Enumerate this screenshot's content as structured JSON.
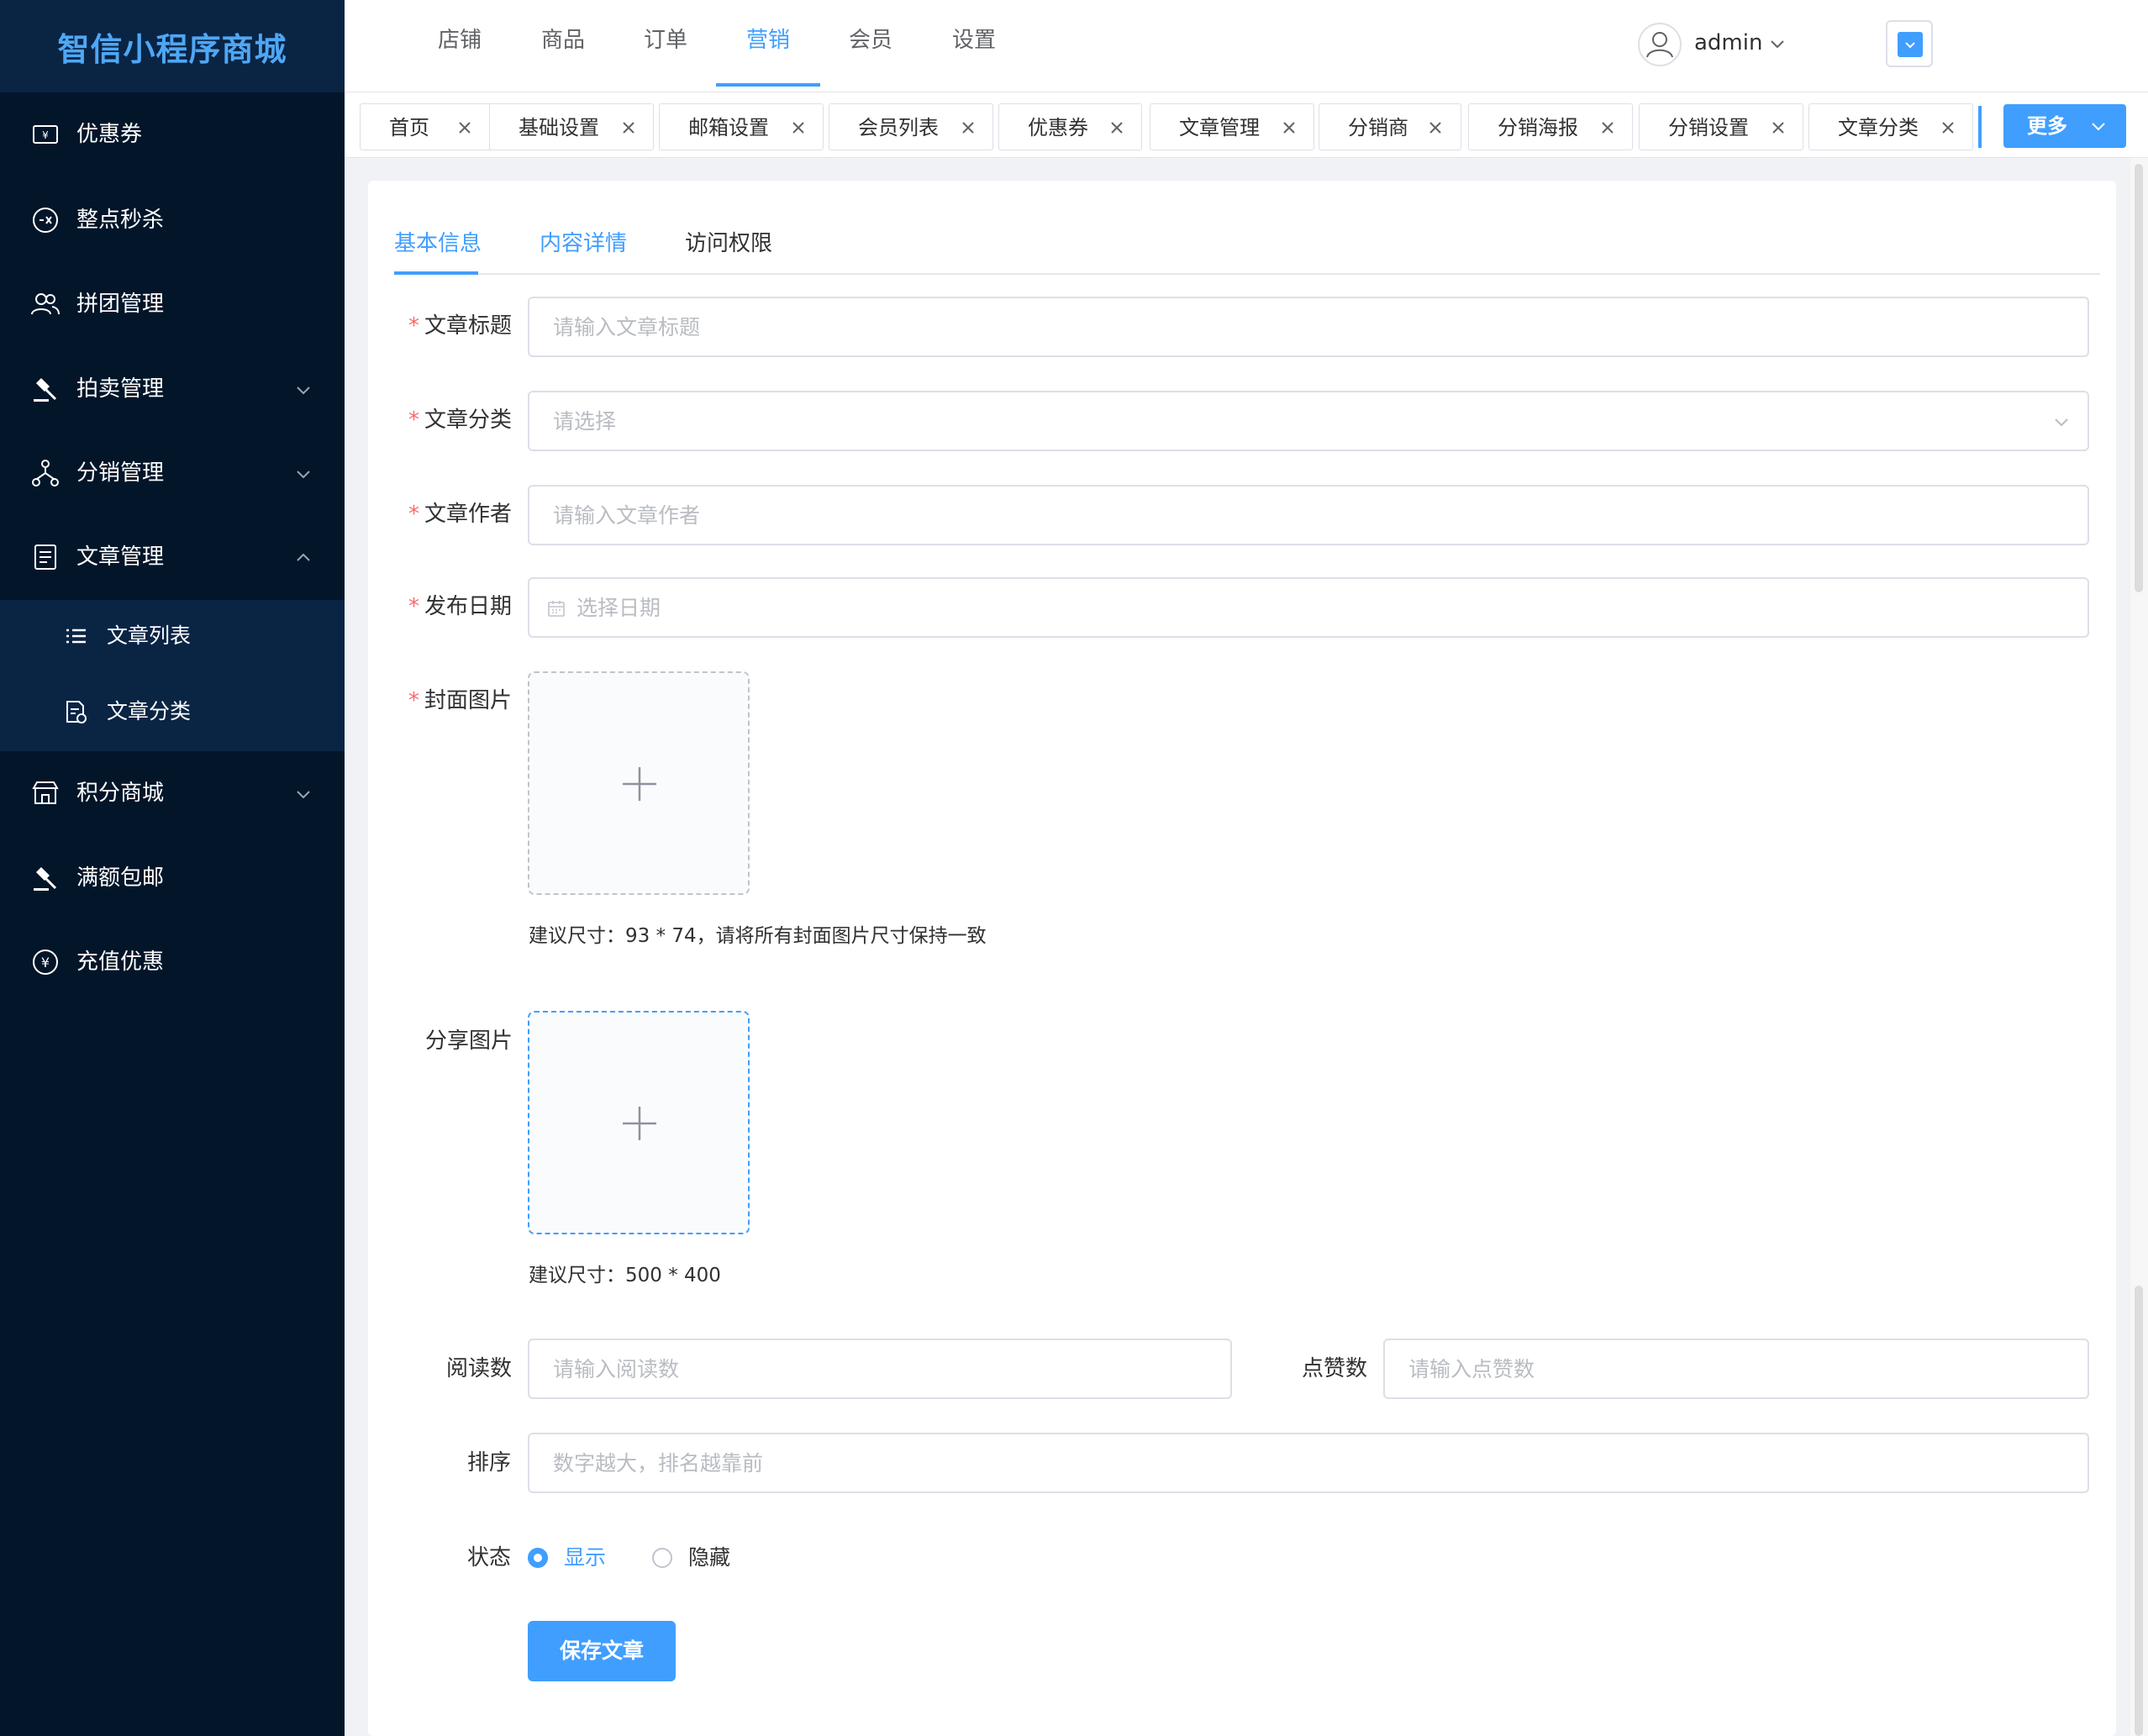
{
  "app": {
    "title": "智信小程序商城"
  },
  "sidebar": {
    "items": [
      {
        "label": "优惠券",
        "icon": "coupon-icon"
      },
      {
        "label": "整点秒杀",
        "icon": "flash-sale-icon"
      },
      {
        "label": "拼团管理",
        "icon": "group-users-icon"
      },
      {
        "label": "拍卖管理",
        "icon": "gavel-icon",
        "expandable": true
      },
      {
        "label": "分销管理",
        "icon": "network-icon",
        "expandable": true
      },
      {
        "label": "文章管理",
        "icon": "document-icon",
        "expanded": true
      },
      {
        "label": "积分商城",
        "icon": "store-icon",
        "expandable": true
      },
      {
        "label": "满额包邮",
        "icon": "gavel-icon"
      },
      {
        "label": "充值优惠",
        "icon": "yuan-coin-icon"
      }
    ],
    "submenu": [
      {
        "label": "文章列表",
        "icon": "list-icon"
      },
      {
        "label": "文章分类",
        "icon": "category-doc-icon"
      }
    ]
  },
  "header": {
    "nav": [
      "店铺",
      "商品",
      "订单",
      "营销",
      "会员",
      "设置"
    ],
    "active_nav": "营销",
    "user": "admin"
  },
  "tabs": {
    "items": [
      "首页",
      "基础设置",
      "邮箱设置",
      "会员列表",
      "优惠券",
      "文章管理",
      "分销商",
      "分销海报",
      "分销设置",
      "文章分类"
    ],
    "more_label": "更多"
  },
  "form": {
    "tabs": [
      "基本信息",
      "内容详情",
      "访问权限"
    ],
    "active_tab": "基本信息",
    "fields": {
      "title": {
        "label": "文章标题",
        "placeholder": "请输入文章标题",
        "required": true
      },
      "category": {
        "label": "文章分类",
        "placeholder": "请选择",
        "required": true
      },
      "author": {
        "label": "文章作者",
        "placeholder": "请输入文章作者",
        "required": true
      },
      "date": {
        "label": "发布日期",
        "placeholder": "选择日期",
        "required": true
      },
      "cover": {
        "label": "封面图片",
        "required": true,
        "hint": "建议尺寸：93 * 74，请将所有封面图片尺寸保持一致"
      },
      "share": {
        "label": "分享图片",
        "hint": "建议尺寸：500 * 400"
      },
      "reads": {
        "label": "阅读数",
        "placeholder": "请输入阅读数"
      },
      "likes": {
        "label": "点赞数",
        "placeholder": "请输入点赞数"
      },
      "sort": {
        "label": "排序",
        "placeholder": "数字越大，排名越靠前"
      },
      "status": {
        "label": "状态",
        "options": [
          "显示",
          "隐藏"
        ],
        "selected": "显示"
      }
    },
    "save_label": "保存文章"
  },
  "colors": {
    "accent": "#409eff",
    "sidebar_bg": "#031529",
    "required": "#f56c6c"
  }
}
